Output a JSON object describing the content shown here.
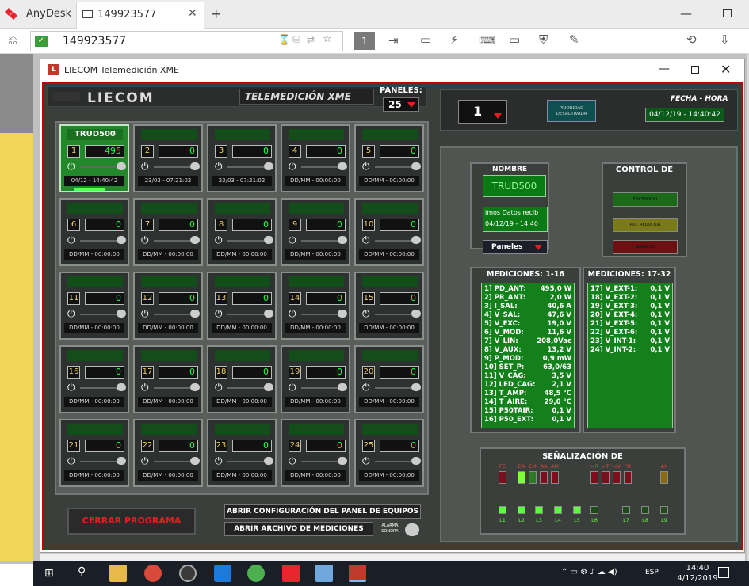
{
  "anydesk": {
    "app_name": "AnyDesk",
    "tab_label": "149923577",
    "tab_close": "✕",
    "new_tab": "+",
    "address": "149923577",
    "page_number": "1"
  },
  "window": {
    "title": "LIECOM Telemedición XME",
    "min": "—",
    "close": "✕"
  },
  "header": {
    "logo": "LIECOM",
    "subtitle": "TELEMEDICIÓN XME",
    "paneles_label": "PANELES:",
    "paneles_value": "25",
    "selector_value": "1",
    "priority_text": "PRIORIDAD DESACTIVADA",
    "fecha_label": "FECHA - HORA",
    "fecha_value": "04/12/19 - 14:40:42"
  },
  "cells": [
    {
      "num": "1",
      "value": "495",
      "time": "04/12 - 14:40:42",
      "title": "TRUD500",
      "active": true
    },
    {
      "num": "2",
      "value": "0",
      "time": "23/03 - 07:21:02",
      "title": "",
      "active": false
    },
    {
      "num": "3",
      "value": "0",
      "time": "23/03 - 07:21:02",
      "title": "",
      "active": false
    },
    {
      "num": "4",
      "value": "0",
      "time": "DD/MM - 00:00:00",
      "title": "",
      "active": false
    },
    {
      "num": "5",
      "value": "0",
      "time": "DD/MM - 00:00:00",
      "title": "",
      "active": false
    },
    {
      "num": "6",
      "value": "0",
      "time": "DD/MM - 00:00:00",
      "title": "",
      "active": false
    },
    {
      "num": "7",
      "value": "0",
      "time": "DD/MM - 00:00:00",
      "title": "",
      "active": false
    },
    {
      "num": "8",
      "value": "0",
      "time": "DD/MM - 00:00:00",
      "title": "",
      "active": false
    },
    {
      "num": "9",
      "value": "0",
      "time": "DD/MM - 00:00:00",
      "title": "",
      "active": false
    },
    {
      "num": "10",
      "value": "0",
      "time": "DD/MM - 00:00:00",
      "title": "",
      "active": false
    },
    {
      "num": "11",
      "value": "0",
      "time": "DD/MM - 00:00:00",
      "title": "",
      "active": false
    },
    {
      "num": "12",
      "value": "0",
      "time": "DD/MM - 00:00:00",
      "title": "",
      "active": false
    },
    {
      "num": "13",
      "value": "0",
      "time": "DD/MM - 00:00:00",
      "title": "",
      "active": false
    },
    {
      "num": "14",
      "value": "0",
      "time": "DD/MM - 00:00:00",
      "title": "",
      "active": false
    },
    {
      "num": "15",
      "value": "0",
      "time": "DD/MM - 00:00:00",
      "title": "",
      "active": false
    },
    {
      "num": "16",
      "value": "0",
      "time": "DD/MM - 00:00:00",
      "title": "",
      "active": false
    },
    {
      "num": "17",
      "value": "0",
      "time": "DD/MM - 00:00:00",
      "title": "",
      "active": false
    },
    {
      "num": "18",
      "value": "0",
      "time": "DD/MM - 00:00:00",
      "title": "",
      "active": false
    },
    {
      "num": "19",
      "value": "0",
      "time": "DD/MM - 00:00:00",
      "title": "",
      "active": false
    },
    {
      "num": "20",
      "value": "0",
      "time": "DD/MM - 00:00:00",
      "title": "",
      "active": false
    },
    {
      "num": "21",
      "value": "0",
      "time": "DD/MM - 00:00:00",
      "title": "",
      "active": false
    },
    {
      "num": "22",
      "value": "0",
      "time": "DD/MM - 00:00:00",
      "title": "",
      "active": false
    },
    {
      "num": "23",
      "value": "0",
      "time": "DD/MM - 00:00:00",
      "title": "",
      "active": false
    },
    {
      "num": "24",
      "value": "0",
      "time": "DD/MM - 00:00:00",
      "title": "",
      "active": false
    },
    {
      "num": "25",
      "value": "0",
      "time": "DD/MM - 00:00:00",
      "title": "",
      "active": false
    }
  ],
  "buttons": {
    "cerrar": "CERRAR PROGRAMA",
    "config": "ABRIR CONFIGURACIÓN DEL PANEL DE EQUIPOS",
    "archivo": "ABRIR ARCHIVO DE MEDICIONES",
    "alarma": "ALARMA SONORA"
  },
  "nombre": {
    "label": "NOMBRE",
    "value": "TRUD500",
    "ultimos_line1": "imos Datos recib",
    "ultimos_line2": "04/12/19 - 14:40",
    "paneles_btn": "Paneles"
  },
  "control": {
    "label": "CONTROL DE",
    "b1": "ENCENDIDO",
    "b2": "POT. REDUCIDA",
    "b3": "APAGADO"
  },
  "mediciones1": {
    "label": "MEDICIONES: 1-16",
    "rows": [
      [
        "1] PD_ANT:",
        "495,0 W"
      ],
      [
        "2] PR_ANT:",
        "2,0 W"
      ],
      [
        "3] I_SAL:",
        "40,6 A"
      ],
      [
        "4] V_SAL:",
        "47,6 V"
      ],
      [
        "5] V_EXC:",
        "19,0 V"
      ],
      [
        "6] V_MOD:",
        "11,6 V"
      ],
      [
        "7] V_LIN:",
        "208,0Vac"
      ],
      [
        "8] V_AUX:",
        "13,2 V"
      ],
      [
        "9] P_MOD:",
        "0,9 mW"
      ],
      [
        "10] SET_P:",
        "63,0/63"
      ],
      [
        "11] V_CAG:",
        "3,5 V"
      ],
      [
        "12] LED_CAG:",
        "2,1 V"
      ],
      [
        "13] T_AMP:",
        "48,5 °C"
      ],
      [
        "14] T_AIRE:",
        "29,0 °C"
      ],
      [
        "15] P50TAIR:",
        "0,1 V"
      ],
      [
        "16] P50_EXT:",
        "0,1 V"
      ]
    ]
  },
  "mediciones2": {
    "label": "MEDICIONES: 17-32",
    "rows": [
      [
        "17] V_EXT-1:",
        "0,1 V"
      ],
      [
        "18] V_EXT-2:",
        "0,1 V"
      ],
      [
        "19] V_EXT-3:",
        "0,1 V"
      ],
      [
        "20] V_EXT-4:",
        "0,1 V"
      ],
      [
        "21] V_EXT-5:",
        "0,1 V"
      ],
      [
        "22] V_EXT-6:",
        "0,1 V"
      ],
      [
        "23] V_INT-1:",
        "0,1 V"
      ],
      [
        "24] V_INT-2:",
        "0,1 V"
      ]
    ]
  },
  "senalizacion": {
    "label": "SEÑALIZACIÓN DE",
    "top_leds": [
      {
        "label": "FC",
        "color": "#7a0f1e"
      },
      {
        "label": "EA",
        "color": "#7dff3c"
      },
      {
        "label": "EM",
        "color": "#2e7a24"
      },
      {
        "label": "AA",
        "color": "#7a0f1e"
      },
      {
        "label": "AM",
        "color": "#7a0f1e"
      },
      {
        "label": ">R",
        "color": "#7a0f1e"
      },
      {
        "label": ">T",
        "color": "#7a0f1e"
      },
      {
        "label": "<V",
        "color": "#7a0f1e"
      },
      {
        "label": "PR",
        "color": "#7a0f1e"
      },
      {
        "label": "AX",
        "color": "#8a6a10"
      }
    ],
    "bottom_leds": [
      {
        "label": "L1",
        "color": "#5cff3c"
      },
      {
        "label": "L2",
        "color": "#5cff3c"
      },
      {
        "label": "L3",
        "color": "#5cff3c"
      },
      {
        "label": "L4",
        "color": "#5cff3c"
      },
      {
        "label": "L5",
        "color": "#5cff3c"
      },
      {
        "label": "L6",
        "color": "#1f4a1a"
      },
      {
        "label": "L7",
        "color": "#1f4a1a"
      },
      {
        "label": "L8",
        "color": "#1f4a1a"
      },
      {
        "label": "L9",
        "color": "#1f4a1a"
      }
    ]
  },
  "taskbar": {
    "lang": "ESP",
    "time": "14:40",
    "date": "4/12/2019"
  }
}
